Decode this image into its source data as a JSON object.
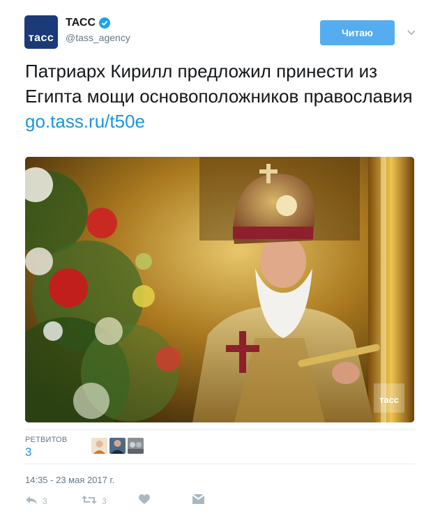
{
  "author": {
    "display_name": "ТАСС",
    "handle": "@tass_agency",
    "avatar_text": "тасс",
    "verified_icon": "verified-badge-icon"
  },
  "follow_button": {
    "label": "Читаю"
  },
  "tweet": {
    "text": "Патриарх Кирилл предложил принести из Египта мощи основоположников православия",
    "link": "go.tass.ru/t50e"
  },
  "photo": {
    "watermark": "тасс"
  },
  "stats": {
    "retweets_label": "РЕТВИТОВ",
    "retweets_count": "3"
  },
  "timestamp": "14:35 - 23 мая 2017 г.",
  "actions": {
    "reply_count": "3",
    "retweet_count": "3"
  },
  "colors": {
    "accent": "#1da1f2",
    "link": "#1b95e0",
    "button": "#55acee",
    "muted": "#657786"
  }
}
